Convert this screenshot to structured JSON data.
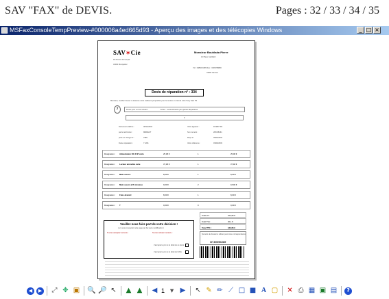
{
  "slide_header": {
    "left_text": "SAV  ''FAX''  de DEVIS.",
    "right_text": "Pages : 32 / 33 / 34 / 35"
  },
  "window": {
    "title": "MSFaxConsoleTempPreview-#000006a4ed665d93 - Aperçu des images et des télécopies Windows",
    "controls": [
      "_",
      "□",
      "×"
    ]
  },
  "document": {
    "logo_text": "SAV",
    "logo_star": "✶",
    "logo_suffix": "Cie",
    "store_addr_1": "18 Avenue du temple",
    "store_addr_2": "34000 Montpellier",
    "customer_name": "Monsieur Bouhlada Pierre",
    "customer_addr_1": "12 Place Garibaldi",
    "customer_tel": "Tél : 0485231089   Fax : 0483789890",
    "customer_city": "34000 Cannes",
    "devis_title": "Devis de réparation n° : 334",
    "intro": "Monsieur, veuillez trouver ci-dessous notre meilleure proposition pour la remise en état de votre Sony Vaio TR",
    "panne_label": "Panne pour ce bon travail ?",
    "panne_text": "Ecran : La décoloration plus jamais disparaisse",
    "panne_value": "F",
    "doc_labels": [
      "Document établi le :",
      "par le technicien :",
      "prise en charge N° :",
      "Durée réparation :"
    ],
    "doc_values": [
      "08/12/2004",
      "MMDEUT",
      "2385",
      "7 ANS"
    ],
    "appareil_labels": [
      "Votre appareil :",
      "Son numéro :",
      "Reçu le :",
      "Votre référence :"
    ],
    "appareil_values": [
      "DCMR TR1",
      "28/C08161",
      "09/03/2004",
      "03/06/2003"
    ],
    "lines": [
      {
        "label": "Désignation :",
        "item": "Alimentation DC 3.5P carte",
        "pu": "25,08 €",
        "qte": "1",
        "total": "25,08 €"
      },
      {
        "label": "Désignation :",
        "item": "Lecteur amovible carte",
        "pu": "37,48 €",
        "qte": "1",
        "total": "37,48 €"
      },
      {
        "label": "Désignation :",
        "item": "Main oeuvre",
        "pu": "8,00 €",
        "qte": "1",
        "total": "8,00 €"
      },
      {
        "label": "Désignation :",
        "item": "Main oeuvre (15 minutes)",
        "pu": "9,00 €",
        "qte": "2",
        "total": "18,00 €"
      },
      {
        "label": "Désignation :",
        "item": "Frais devis/H",
        "pu": "8,00 €",
        "qte": "1",
        "total": "8,00 €"
      },
      {
        "label": "Désignation :",
        "item": "T",
        "pu": "0,00 €",
        "qte": "0",
        "total": "0,00 €"
      }
    ],
    "decision_title": "Veuillez nous faire part de votre décision !",
    "decision_sub": "( en nous renvoyant cette page par fax sans modification )",
    "option_yes": "Si vous acceptez ce devis :",
    "option_no": "Si vous refusez ce devis :",
    "accept_label": "J'accepte le prix et le délai de ce devis",
    "refuse_label": "J'accepte le prix et le délai de l'offre",
    "totals": [
      {
        "label": "Total HT :",
        "value": "102,56 €"
      },
      {
        "label": "Total TVA :",
        "value": "20,1 €"
      },
      {
        "label": "Total TTC :",
        "value": "122,66 €"
      }
    ],
    "fax_box": "Numéro de dossier à utiliser pour toute correspondance :",
    "fax_number": "CH 3000002385"
  },
  "toolbar": {
    "page_selector": "1"
  }
}
